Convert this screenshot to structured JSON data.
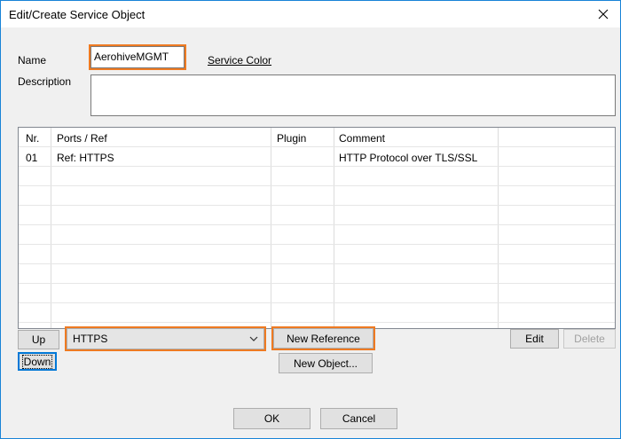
{
  "window": {
    "title": "Edit/Create Service Object"
  },
  "form": {
    "name_label": "Name",
    "name_value": "AerohiveMGMT",
    "service_color_link": "Service Color",
    "description_label": "Description",
    "description_value": ""
  },
  "table": {
    "columns": [
      "Nr.",
      "Ports / Ref",
      "Plugin",
      "Comment"
    ],
    "rows": [
      {
        "nr": "01",
        "ref": "Ref: HTTPS",
        "plugin": "",
        "comment": "HTTP Protocol over TLS/SSL"
      }
    ]
  },
  "controls": {
    "up_label": "Up",
    "down_label": "Down",
    "reference_select_value": "HTTPS",
    "new_reference_label": "New Reference",
    "new_object_label": "New Object...",
    "edit_label": "Edit",
    "delete_label": "Delete",
    "ok_label": "OK",
    "cancel_label": "Cancel"
  },
  "colors": {
    "highlight": "#ee7a22",
    "window_border": "#1883d7"
  },
  "icons": {
    "close": "close-icon",
    "dropdown": "chevron-down-icon"
  }
}
